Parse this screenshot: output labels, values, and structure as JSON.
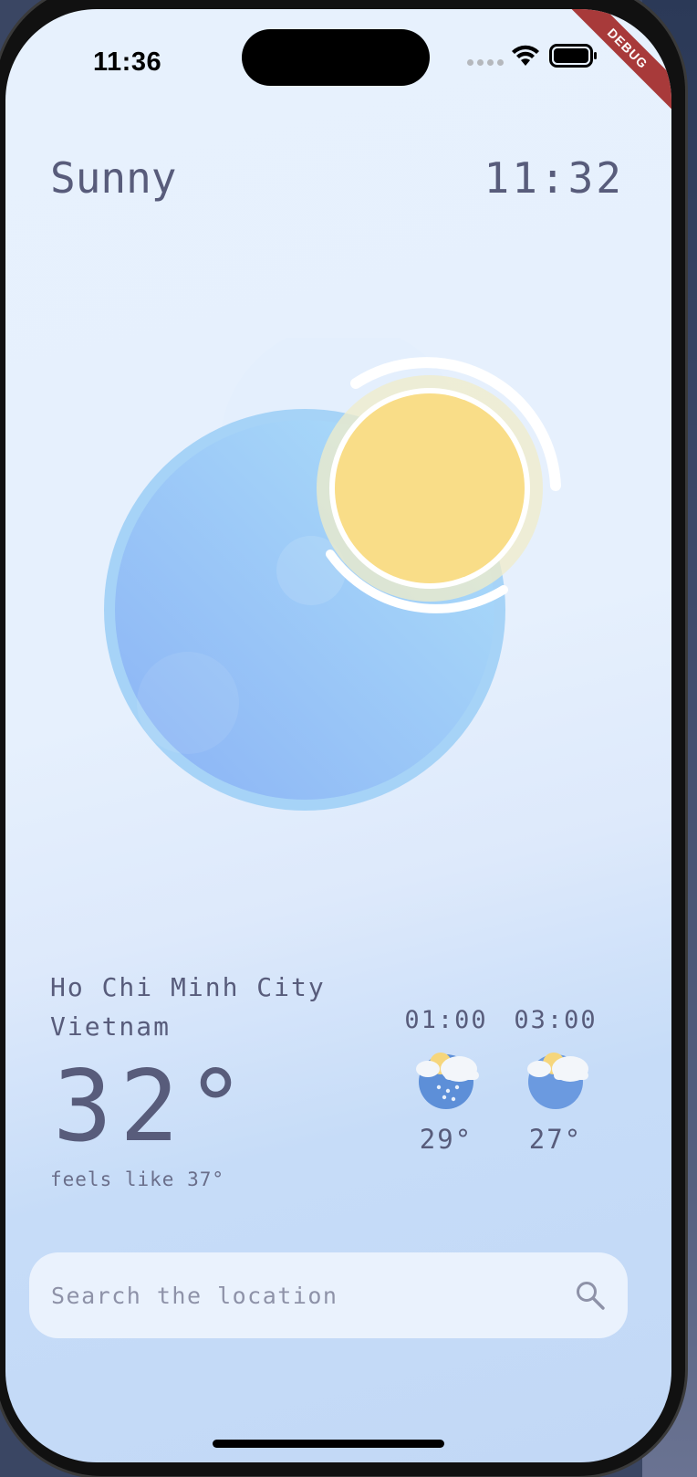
{
  "status_bar": {
    "time": "11:36"
  },
  "debug_banner": "DEBUG",
  "header": {
    "condition": "Sunny",
    "clock": "11:32"
  },
  "location": {
    "city": "Ho Chi Minh City",
    "country": "Vietnam"
  },
  "current": {
    "temperature": "32°",
    "feels_like": "feels like 37°"
  },
  "forecast": [
    {
      "time": "01:00",
      "temp": "29°",
      "icon": "partly-cloudy-rain-icon"
    },
    {
      "time": "03:00",
      "temp": "27°",
      "icon": "partly-cloudy-icon"
    }
  ],
  "search": {
    "placeholder": "Search the location"
  },
  "colors": {
    "text": "#585c7b",
    "sun": "#f9dd88",
    "moon": "#9fcbf6"
  }
}
